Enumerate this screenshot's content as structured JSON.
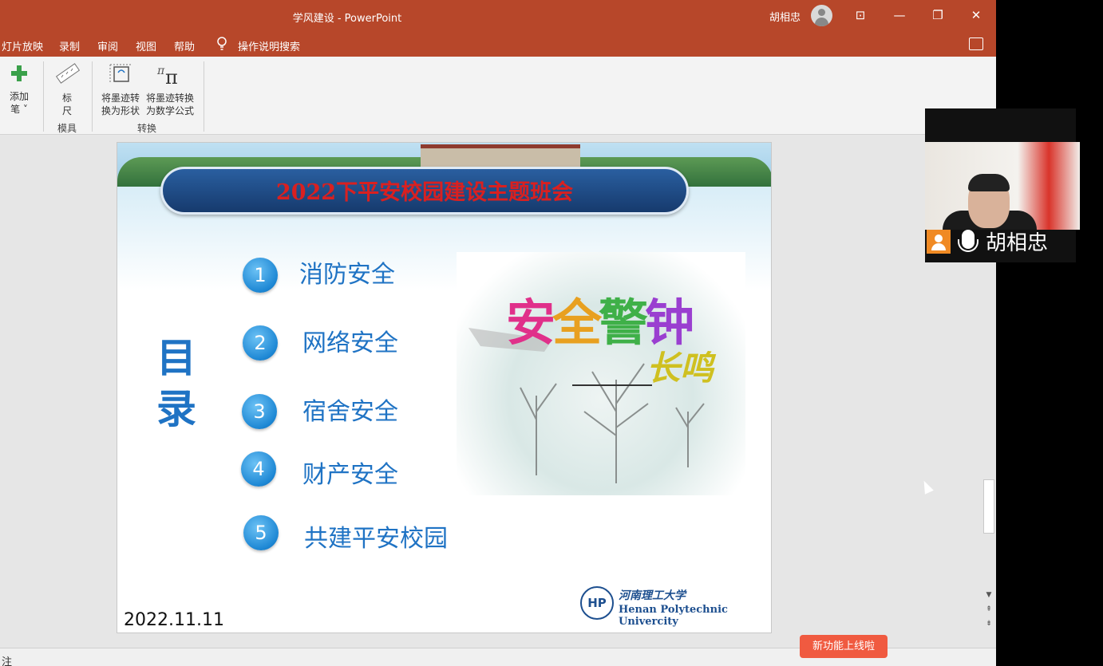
{
  "titlebar": {
    "title": "学风建设 - PowerPoint",
    "user": "胡相忠",
    "restore_glyph": "⊡",
    "minimize_glyph": "—",
    "maximize_glyph": "❐",
    "close_glyph": "✕"
  },
  "menu": {
    "tabs": [
      "灯片放映",
      "录制",
      "审阅",
      "视图",
      "帮助"
    ],
    "search_label": "操作说明搜索"
  },
  "ribbon": {
    "add_pen": {
      "label_1": "添加",
      "label_2": "笔 ˅"
    },
    "ruler": {
      "label_1": "标",
      "label_2": "尺"
    },
    "ink_to_shape": {
      "label_1": "将墨迹转",
      "label_2": "换为形状"
    },
    "ink_to_math": {
      "label_1": "将墨迹转换",
      "label_2": "为数学公式"
    },
    "groups": {
      "stencils": "模具",
      "convert": "转换"
    }
  },
  "slide": {
    "banner_title": "2022下平安校园建设主题班会",
    "mulu_1": "目",
    "mulu_2": "录",
    "items": [
      {
        "num": "1",
        "text": "消防安全"
      },
      {
        "num": "2",
        "text": "网络安全"
      },
      {
        "num": "3",
        "text": "宿舍安全"
      },
      {
        "num": "4",
        "text": "财产安全"
      },
      {
        "num": "5",
        "text": "共建平安校园"
      }
    ],
    "illus_main": [
      "安",
      "全",
      "警",
      "钟"
    ],
    "illus_sub": "长鸣",
    "date": "2022.11.11",
    "logo_mark": "HP",
    "logo_cn": "河南理工大学",
    "logo_en": "Henan Polytechnic Univercity"
  },
  "status": {
    "notes": "注"
  },
  "toast": {
    "text": "新功能上线啦"
  },
  "video": {
    "name": "胡相忠"
  },
  "colors": {
    "accent": "#b7472a",
    "slide_blue": "#1f73c4",
    "toast": "#f05a40",
    "badge": "#f08a24"
  }
}
